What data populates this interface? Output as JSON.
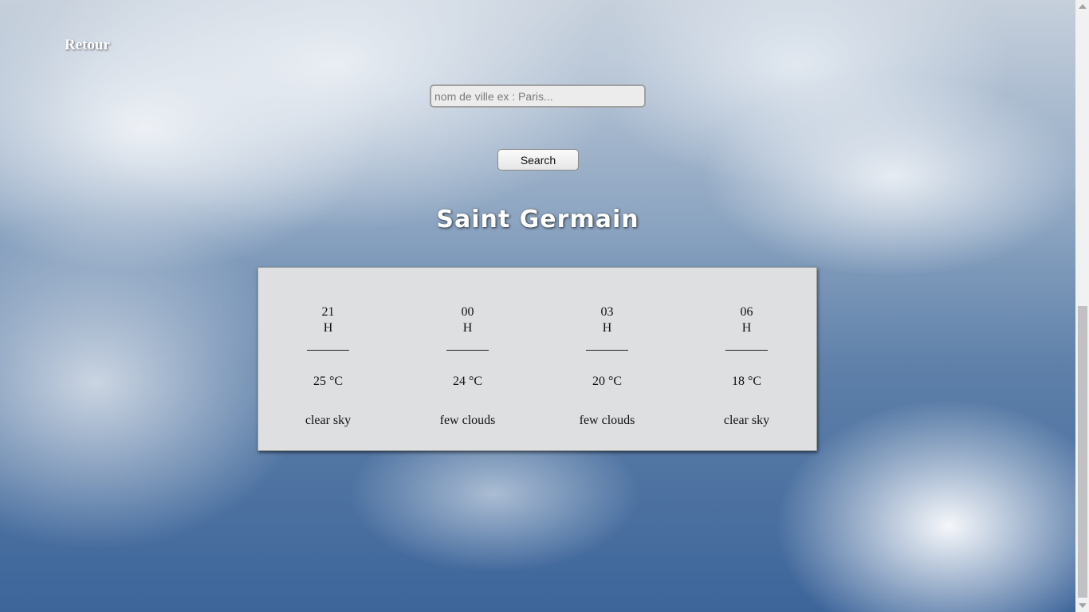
{
  "nav": {
    "back_label": "Retour"
  },
  "search": {
    "placeholder": "nom de ville ex : Paris...",
    "value": "",
    "button_label": "Search"
  },
  "city": {
    "name": "Saint Germain"
  },
  "forecast": [
    {
      "hour": "21",
      "unit": "H",
      "temp": "25 °C",
      "desc": "clear sky"
    },
    {
      "hour": "00",
      "unit": "H",
      "temp": "24 °C",
      "desc": "few clouds"
    },
    {
      "hour": "03",
      "unit": "H",
      "temp": "20 °C",
      "desc": "few clouds"
    },
    {
      "hour": "06",
      "unit": "H",
      "temp": "18 °C",
      "desc": "clear sky"
    }
  ],
  "colors": {
    "panel_background": "#dedfe1",
    "title_text": "#ffffff",
    "sky": "#5e80a9"
  }
}
